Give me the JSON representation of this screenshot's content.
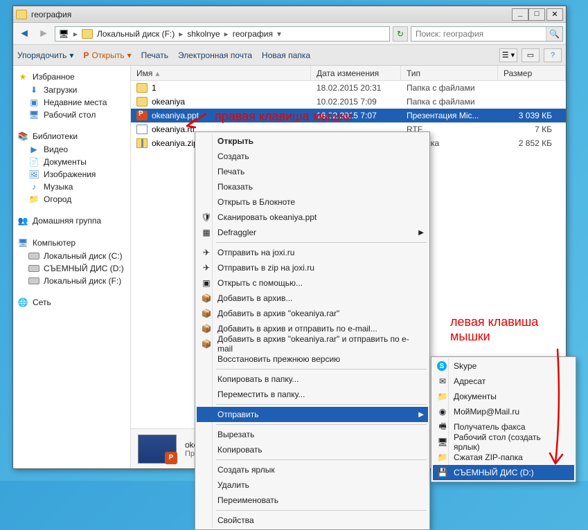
{
  "window": {
    "title": "география"
  },
  "breadcrumb": {
    "root_icon": "computer",
    "parts": [
      "Локальный диск (F:)",
      "shkolnye",
      "география"
    ]
  },
  "search": {
    "placeholder": "Поиск: география"
  },
  "toolbar": {
    "organize": "Упорядочить",
    "open": "Открыть",
    "print": "Печать",
    "email": "Электронная почта",
    "newfolder": "Новая папка"
  },
  "sidebar": {
    "favorites": {
      "label": "Избранное",
      "items": [
        "Загрузки",
        "Недавние места",
        "Рабочий стол"
      ]
    },
    "libraries": {
      "label": "Библиотеки",
      "items": [
        "Видео",
        "Документы",
        "Изображения",
        "Музыка",
        "Огород"
      ]
    },
    "homegroup": {
      "label": "Домашняя группа"
    },
    "computer": {
      "label": "Компьютер",
      "items": [
        "Локальный диск (C:)",
        "СЪЕМНЫЙ ДИС (D:)",
        "Локальный диск (F:)"
      ]
    },
    "network": {
      "label": "Сеть"
    }
  },
  "columns": {
    "name": "Имя",
    "date": "Дата изменения",
    "type": "Тип",
    "size": "Размер"
  },
  "files": [
    {
      "icon": "fold",
      "name": "1",
      "date": "18.02.2015 20:31",
      "type": "Папка с файлами",
      "size": ""
    },
    {
      "icon": "fold",
      "name": "okeaniya",
      "date": "10.02.2015 7:09",
      "type": "Папка с файлами",
      "size": ""
    },
    {
      "icon": "ppt",
      "name": "okeaniya.ppt",
      "date": "16.02.2015 7:07",
      "type": "Презентация Mic...",
      "size": "3 039 КБ",
      "selected": true
    },
    {
      "icon": "rtf",
      "name": "okeaniya.rtf",
      "date": "",
      "type": "RTF",
      "size": "7 КБ"
    },
    {
      "icon": "zip",
      "name": "okeaniya.zip",
      "date": "",
      "type": "IP-папка",
      "size": "2 852 КБ"
    }
  ],
  "contextmenu": [
    {
      "label": "Открыть",
      "bold": true
    },
    {
      "label": "Создать"
    },
    {
      "label": "Печать"
    },
    {
      "label": "Показать"
    },
    {
      "label": "Открыть в Блокноте"
    },
    {
      "label": "Сканировать okeaniya.ppt",
      "icon": "🛡"
    },
    {
      "label": "Defraggler",
      "icon": "▦",
      "sub": true
    },
    {
      "sep": true
    },
    {
      "label": "Отправить на joxi.ru",
      "icon": "✈"
    },
    {
      "label": "Отправить в zip на joxi.ru",
      "icon": "✈"
    },
    {
      "label": "Открыть с помощью...",
      "icon": "▣"
    },
    {
      "label": "Добавить в архив...",
      "icon": "📦"
    },
    {
      "label": "Добавить в архив \"okeaniya.rar\"",
      "icon": "📦"
    },
    {
      "label": "Добавить в архив и отправить по e-mail...",
      "icon": "📦"
    },
    {
      "label": "Добавить в архив \"okeaniya.rar\" и отправить по e-mail",
      "icon": "📦"
    },
    {
      "label": "Восстановить прежнюю версию"
    },
    {
      "sep": true
    },
    {
      "label": "Копировать в папку..."
    },
    {
      "label": "Переместить в папку..."
    },
    {
      "sep": true
    },
    {
      "label": "Отправить",
      "sub": true,
      "hilite": true
    },
    {
      "sep": true
    },
    {
      "label": "Вырезать"
    },
    {
      "label": "Копировать"
    },
    {
      "sep": true
    },
    {
      "label": "Создать ярлык"
    },
    {
      "label": "Удалить"
    },
    {
      "label": "Переименовать"
    },
    {
      "sep": true
    },
    {
      "label": "Свойства"
    }
  ],
  "sendto": [
    {
      "label": "Skype",
      "icon": "S",
      "iconClass": "skype"
    },
    {
      "label": "Адресат",
      "icon": "✉"
    },
    {
      "label": "Документы",
      "icon": "📁"
    },
    {
      "label": "МойМир@Mail.ru",
      "icon": "◉"
    },
    {
      "label": "Получатель факса",
      "icon": "🖷"
    },
    {
      "label": "Рабочий стол (создать ярлык)",
      "icon": "🖥"
    },
    {
      "label": "Сжатая ZIP-папка",
      "icon": "📁"
    },
    {
      "label": "СЪЕМНЫЙ ДИС (D:)",
      "icon": "💾",
      "hilite": true
    }
  ],
  "details": {
    "filename": "okeaniya.ppt",
    "filetype": "Презентация Microsoft PowerP..."
  },
  "annotations": {
    "right_click": "правая клавиша мышки",
    "left_click": "левая клавиша\nмышки"
  }
}
